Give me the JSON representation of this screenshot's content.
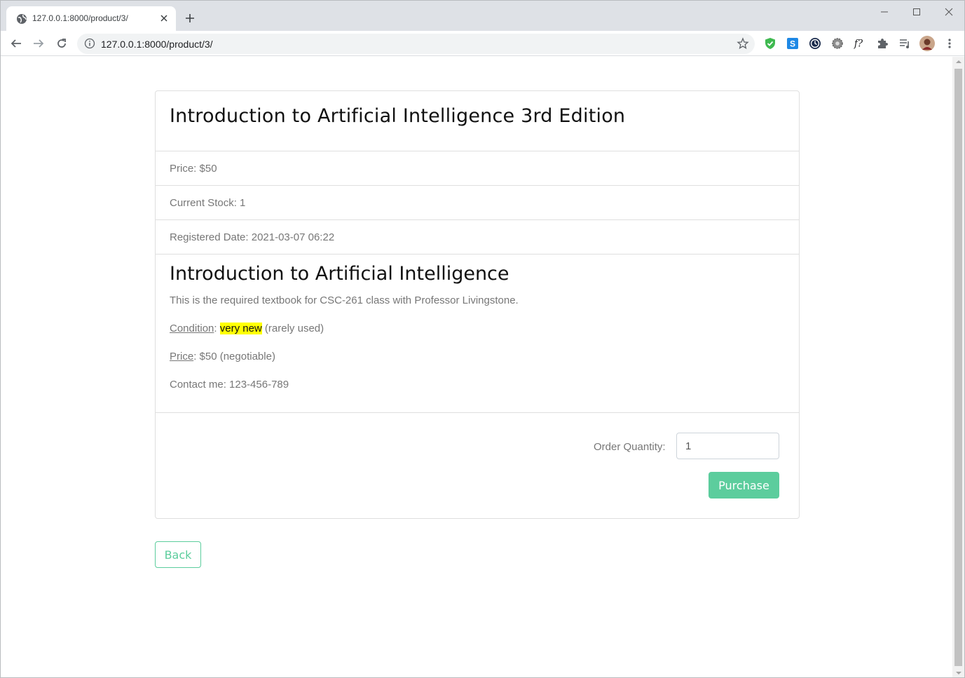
{
  "browser": {
    "tab_title": "127.0.0.1:8000/product/3/",
    "url": "127.0.0.1:8000/product/3/",
    "extensions": [
      "shield-check-icon",
      "s-badge-icon",
      "clock-icon",
      "gear-icon",
      "f-question-icon",
      "puzzle-icon",
      "playlist-icon",
      "profile-avatar"
    ]
  },
  "product": {
    "title": "Introduction to Artificial Intelligence 3rd Edition",
    "price_line": "Price: $50",
    "stock_line": "Current Stock: 1",
    "date_line": "Registered Date: 2021-03-07 06:22"
  },
  "description": {
    "heading": "Introduction to Artificial Intelligence",
    "intro": "This is the required textbook for CSC-261 class with Professor Livingstone.",
    "condition_label": "Condition",
    "condition_sep": ": ",
    "condition_value": "very new",
    "condition_note": " (rarely used)",
    "price_label": "Price",
    "price_value": ": $50 (negotiable)",
    "contact": "Contact me: 123-456-789"
  },
  "order": {
    "quantity_label": "Order Quantity:",
    "quantity_value": "1",
    "purchase_label": "Purchase"
  },
  "back_label": "Back",
  "colors": {
    "accent": "#5ccd9d",
    "highlight": "#ffff00",
    "muted_text": "#777777"
  }
}
